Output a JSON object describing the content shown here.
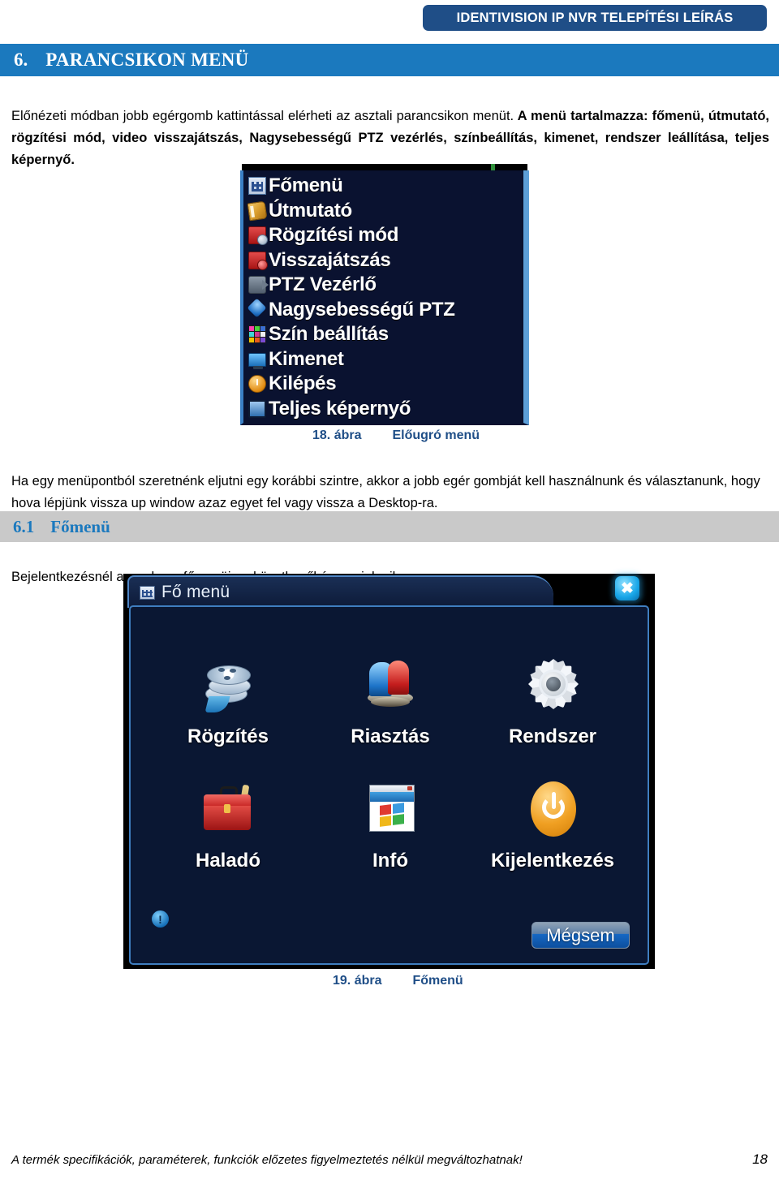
{
  "header": {
    "banner_text": "IDENTIVISION IP NVR TELEPÍTÉSI LEÍRÁS",
    "banner_color": "#1F4E87"
  },
  "section": {
    "number": "6.",
    "title": "PARANCSIKON MENÜ",
    "bar_color": "#1B79BE"
  },
  "intro": {
    "line1": "Előnézeti módban jobb egérgomb kattintással elérheti az asztali parancsikon menüt.",
    "line1_bold_tail": " A menü tartalmazza:",
    "line2_bold": "főmenü, útmutató, rögzítési mód, video visszajátszás, Nagysebességű PTZ vezérlés, színbeállítás, kimenet, rendszer leállítása, teljes képernyő."
  },
  "popup_menu": {
    "items": [
      {
        "label": "Főmenü",
        "icon": "grid-icon"
      },
      {
        "label": "Útmutató",
        "icon": "book-icon"
      },
      {
        "label": "Rögzítési mód",
        "icon": "record-mode-icon"
      },
      {
        "label": "Visszajátszás",
        "icon": "playback-icon"
      },
      {
        "label": "PTZ Vezérlő",
        "icon": "ptz-camera-icon"
      },
      {
        "label": "Nagysebességű PTZ",
        "icon": "high-speed-ptz-icon"
      },
      {
        "label": "Szín beállítás",
        "icon": "color-palette-icon"
      },
      {
        "label": "Kimenet",
        "icon": "monitor-output-icon"
      },
      {
        "label": "Kilépés",
        "icon": "power-exit-icon"
      },
      {
        "label": "Teljes képernyő",
        "icon": "fullscreen-icon"
      }
    ]
  },
  "figure18": {
    "number": "18. ábra",
    "title": "Előugró menü"
  },
  "mid_paragraph": {
    "text": "Ha egy menüpontból szeretnénk eljutni egy korábbi szintre, akkor a jobb egér gombját kell használnunk és választanunk, hogy hova lépjünk vissza up window azaz egyet fel vagy vissza a Desktop-ra."
  },
  "subsection": {
    "number": "6.1",
    "title": "Főmenü",
    "bar_color": "#C9C9C9",
    "text_color": "#1B79BE"
  },
  "lead_in": {
    "text": "Bejelentkezésnél a rendszer főmenüje a következőképpen jelenik meg:"
  },
  "main_menu_dialog": {
    "title": "Fő menü",
    "title_icon": "grid-icon",
    "close_icon": "close-icon",
    "close_glyph": "✖",
    "info_icon": "info-exclamation-icon",
    "info_glyph": "!",
    "cancel_label": "Mégsem",
    "tiles": [
      {
        "label": "Rögzítés",
        "icon": "film-reel-icon"
      },
      {
        "label": "Riasztás",
        "icon": "alarm-siren-icon"
      },
      {
        "label": "Rendszer",
        "icon": "gear-icon"
      },
      {
        "label": "Haladó",
        "icon": "toolbox-icon"
      },
      {
        "label": "Infó",
        "icon": "window-info-icon"
      },
      {
        "label": "Kijelentkezés",
        "icon": "power-icon"
      }
    ]
  },
  "figure19": {
    "number": "19. ábra",
    "title": "Főmenü"
  },
  "footer": {
    "note": "A termék specifikációk, paraméterek, funkciók előzetes figyelmeztetés nélkül megváltozhatnak!",
    "page": "18"
  }
}
